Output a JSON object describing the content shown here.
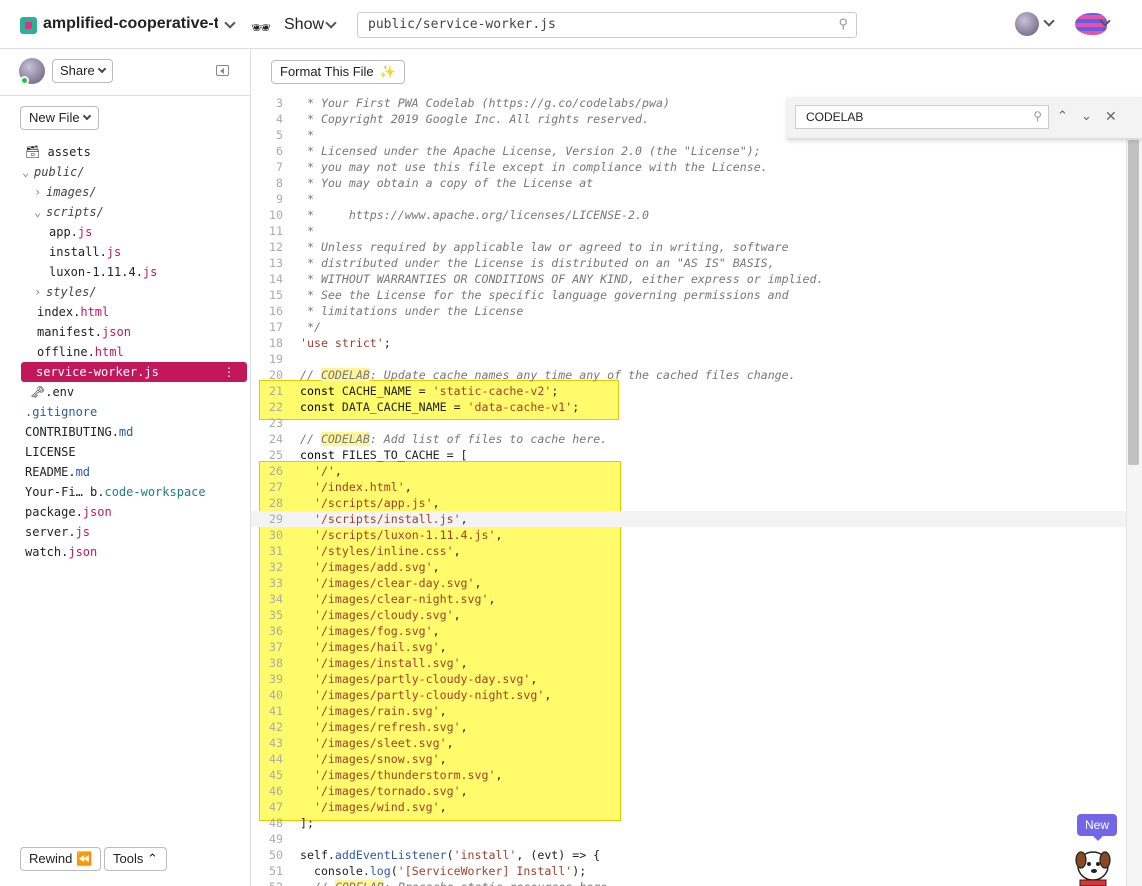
{
  "topbar": {
    "project_name": "amplified-cooperative-t...",
    "show_label": "Show",
    "file_path": "public/service-worker.js",
    "glasses_icon": "glasses-icon",
    "accent": "#c2185b"
  },
  "sidebar": {
    "share_label": "Share",
    "new_file_label": "New File",
    "rewind_label": "Rewind",
    "tools_label": "Tools",
    "tree": [
      {
        "name": "assets",
        "ext": ""
      },
      {
        "name": "public/",
        "ext": ""
      },
      {
        "name": "images/",
        "ext": ""
      },
      {
        "name": "scripts/",
        "ext": ""
      },
      {
        "name": "app.",
        "ext": "js"
      },
      {
        "name": "install.",
        "ext": "js"
      },
      {
        "name": "luxon-1.11.4.",
        "ext": "js"
      },
      {
        "name": "styles/",
        "ext": ""
      },
      {
        "name": "index.",
        "ext": "html"
      },
      {
        "name": "manifest.",
        "ext": "json"
      },
      {
        "name": "offline.",
        "ext": "html"
      },
      {
        "name": "service-worker.",
        "ext": "js"
      },
      {
        "name": ".env",
        "ext": ""
      },
      {
        "name": ".gitignore",
        "ext": ""
      },
      {
        "name": "CONTRIBUTING.",
        "ext": "md"
      },
      {
        "name": "LICENSE",
        "ext": ""
      },
      {
        "name": "README.",
        "ext": "md"
      },
      {
        "name": "Your-Fi… b.",
        "ext": "code-workspace"
      },
      {
        "name": "package.",
        "ext": "json"
      },
      {
        "name": "server.",
        "ext": "js"
      },
      {
        "name": "watch.",
        "ext": "json"
      }
    ]
  },
  "editor": {
    "format_label": "Format This File",
    "find_query": "CODELAB",
    "badge": "New",
    "lines": [
      {
        "n": "3",
        "t": " * Your First PWA Codelab (https://g.co/codelabs/pwa)"
      },
      {
        "n": "4",
        "t": " * Copyright 2019 Google Inc. All rights reserved."
      },
      {
        "n": "5",
        "t": " *"
      },
      {
        "n": "6",
        "t": " * Licensed under the Apache License, Version 2.0 (the \"License\");"
      },
      {
        "n": "7",
        "t": " * you may not use this file except in compliance with the License."
      },
      {
        "n": "8",
        "t": " * You may obtain a copy of the License at"
      },
      {
        "n": "9",
        "t": " *"
      },
      {
        "n": "10",
        "t": " *     https://www.apache.org/licenses/LICENSE-2.0"
      },
      {
        "n": "11",
        "t": " *"
      },
      {
        "n": "12",
        "t": " * Unless required by applicable law or agreed to in writing, software"
      },
      {
        "n": "13",
        "t": " * distributed under the License is distributed on an \"AS IS\" BASIS,"
      },
      {
        "n": "14",
        "t": " * WITHOUT WARRANTIES OR CONDITIONS OF ANY KIND, either express or implied."
      },
      {
        "n": "15",
        "t": " * See the License for the specific language governing permissions and"
      },
      {
        "n": "16",
        "t": " * limitations under the License"
      },
      {
        "n": "17",
        "t": " */"
      },
      {
        "n": "18",
        "t": "'use strict';"
      },
      {
        "n": "19",
        "t": ""
      },
      {
        "n": "20",
        "t": "// CODELAB: Update cache names any time any of the cached files change."
      },
      {
        "n": "21",
        "t": "const CACHE_NAME = 'static-cache-v2';"
      },
      {
        "n": "22",
        "t": "const DATA_CACHE_NAME = 'data-cache-v1';"
      },
      {
        "n": "23",
        "t": ""
      },
      {
        "n": "24",
        "t": "// CODELAB: Add list of files to cache here."
      },
      {
        "n": "25",
        "t": "const FILES_TO_CACHE = ["
      },
      {
        "n": "26",
        "t": "  '/',"
      },
      {
        "n": "27",
        "t": "  '/index.html',"
      },
      {
        "n": "28",
        "t": "  '/scripts/app.js',"
      },
      {
        "n": "29",
        "t": "  '/scripts/install.js',"
      },
      {
        "n": "30",
        "t": "  '/scripts/luxon-1.11.4.js',"
      },
      {
        "n": "31",
        "t": "  '/styles/inline.css',"
      },
      {
        "n": "32",
        "t": "  '/images/add.svg',"
      },
      {
        "n": "33",
        "t": "  '/images/clear-day.svg',"
      },
      {
        "n": "34",
        "t": "  '/images/clear-night.svg',"
      },
      {
        "n": "35",
        "t": "  '/images/cloudy.svg',"
      },
      {
        "n": "36",
        "t": "  '/images/fog.svg',"
      },
      {
        "n": "37",
        "t": "  '/images/hail.svg',"
      },
      {
        "n": "38",
        "t": "  '/images/install.svg',"
      },
      {
        "n": "39",
        "t": "  '/images/partly-cloudy-day.svg',"
      },
      {
        "n": "40",
        "t": "  '/images/partly-cloudy-night.svg',"
      },
      {
        "n": "41",
        "t": "  '/images/rain.svg',"
      },
      {
        "n": "42",
        "t": "  '/images/refresh.svg',"
      },
      {
        "n": "43",
        "t": "  '/images/sleet.svg',"
      },
      {
        "n": "44",
        "t": "  '/images/snow.svg',"
      },
      {
        "n": "45",
        "t": "  '/images/thunderstorm.svg',"
      },
      {
        "n": "46",
        "t": "  '/images/tornado.svg',"
      },
      {
        "n": "47",
        "t": "  '/images/wind.svg',"
      },
      {
        "n": "48",
        "t": "];"
      },
      {
        "n": "49",
        "t": ""
      },
      {
        "n": "50",
        "t": "self.addEventListener('install', (evt) => {"
      },
      {
        "n": "51",
        "t": "  console.log('[ServiceWorker] Install');"
      },
      {
        "n": "52",
        "t": "  // CODELAB: Precache static resources here."
      }
    ]
  }
}
